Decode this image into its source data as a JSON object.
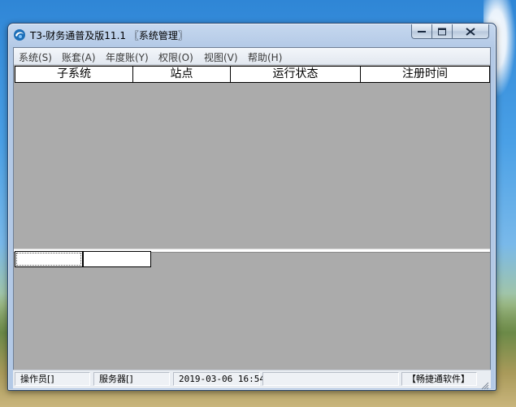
{
  "window": {
    "title": "T3-财务通普及版11.1 〖系统管理〗"
  },
  "menu": [
    "系统(S)",
    "账套(A)",
    "年度账(Y)",
    "权限(O)",
    "视图(V)",
    "帮助(H)"
  ],
  "grid": {
    "columns": [
      "子系统",
      "站点",
      "运行状态",
      "注册时间"
    ]
  },
  "status": {
    "operator": "操作员[]",
    "server": "服务器[]",
    "datetime": "2019-03-06  16:54",
    "empty": "",
    "vendor": "【畅捷通软件】"
  },
  "colors": {
    "client_area": "#ababab",
    "title_bar": "#b3c9e6"
  },
  "icons": {
    "app": "swirl-logo-icon",
    "minimize": "minimize-icon",
    "maximize": "maximize-icon",
    "close": "close-icon",
    "resize": "resize-grip-icon"
  }
}
